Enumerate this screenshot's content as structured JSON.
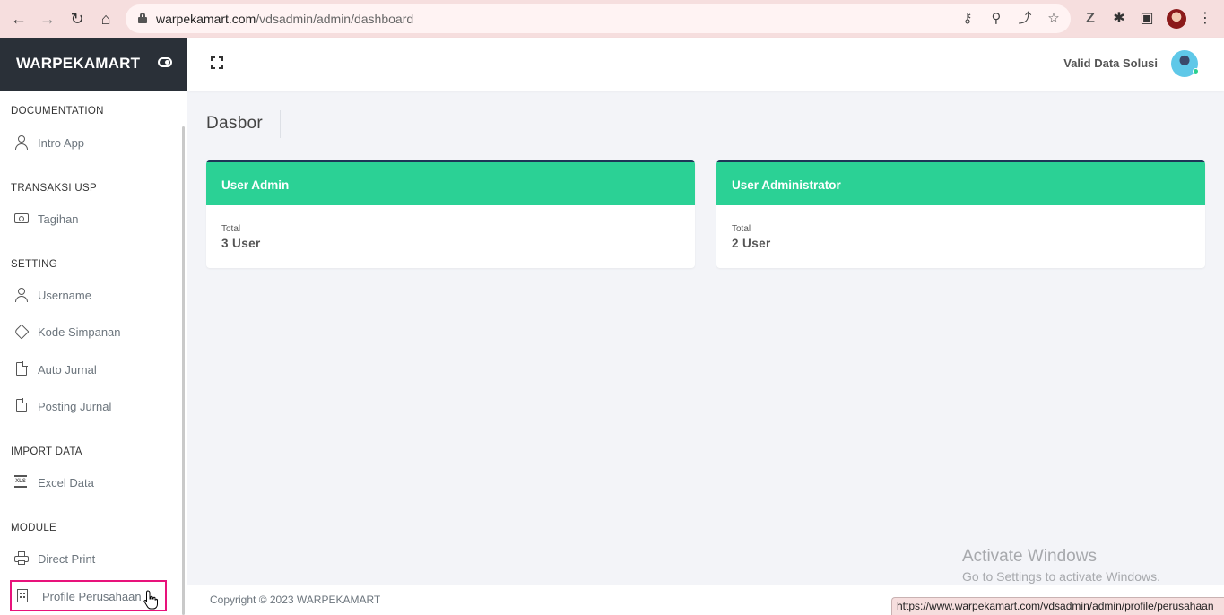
{
  "browser": {
    "url_host": "warpekamart.com",
    "url_path": "/vdsadmin/admin/dashboard",
    "status_url": "https://www.warpekamart.com/vdsadmin/admin/profile/perusahaan"
  },
  "brand": {
    "name": "WARPEKAMART"
  },
  "header": {
    "user_name": "Valid Data Solusi"
  },
  "sidebar": {
    "sections": [
      {
        "title": "DOCUMENTATION",
        "items": [
          {
            "label": "Intro App",
            "icon": "user-icon"
          }
        ]
      },
      {
        "title": "TRANSAKSI USP",
        "items": [
          {
            "label": "Tagihan",
            "icon": "money-icon"
          }
        ]
      },
      {
        "title": "SETTING",
        "items": [
          {
            "label": "Username",
            "icon": "user-icon"
          },
          {
            "label": "Kode Simpanan",
            "icon": "tag-icon"
          },
          {
            "label": "Auto Jurnal",
            "icon": "file-icon"
          },
          {
            "label": "Posting Jurnal",
            "icon": "file-icon"
          }
        ]
      },
      {
        "title": "IMPORT DATA",
        "items": [
          {
            "label": "Excel Data",
            "icon": "excel-icon"
          }
        ]
      },
      {
        "title": "MODULE",
        "items": [
          {
            "label": "Direct Print",
            "icon": "printer-icon"
          },
          {
            "label": "Profile Perusahaan",
            "icon": "building-icon"
          }
        ]
      }
    ]
  },
  "main": {
    "page_title": "Dasbor",
    "cards": [
      {
        "title": "User Admin",
        "subtitle": "Total",
        "value": "3 User"
      },
      {
        "title": "User Administrator",
        "subtitle": "Total",
        "value": "2 User"
      }
    ]
  },
  "footer": {
    "copyright": "Copyright © 2023 WARPEKAMART"
  },
  "watermark": {
    "title": "Activate Windows",
    "subtitle": "Go to Settings to activate Windows."
  },
  "colors": {
    "brand_bg": "#2a3038",
    "card_header": "#2bd195",
    "highlight": "#e8127b",
    "browser_chrome": "#f6dede"
  }
}
